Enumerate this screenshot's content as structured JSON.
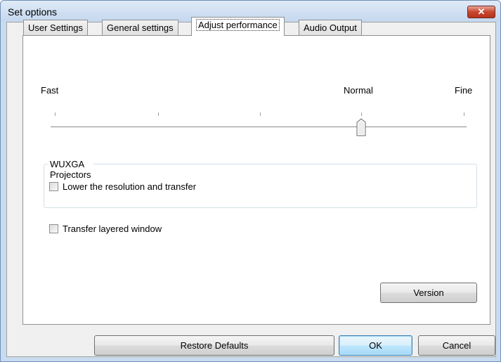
{
  "window": {
    "title": "Set options"
  },
  "tabs": [
    {
      "label": "User Settings"
    },
    {
      "label": "General settings"
    },
    {
      "label": "Adjust performance"
    },
    {
      "label": "Audio Output"
    }
  ],
  "active_tab": "Adjust performance",
  "performance": {
    "slider": {
      "left_label": "Fast",
      "mid_label": "Normal",
      "right_label": "Fine",
      "tick_count": 5,
      "selected_index": 3
    },
    "group": {
      "title": "WUXGA Projectors",
      "lower_resolution": {
        "label": "Lower the resolution and transfer",
        "checked": false
      }
    },
    "transfer_layered": {
      "label": "Transfer layered window",
      "checked": false
    },
    "version_button": "Version"
  },
  "footer": {
    "restore_defaults": "Restore Defaults",
    "ok": "OK",
    "cancel": "Cancel"
  }
}
